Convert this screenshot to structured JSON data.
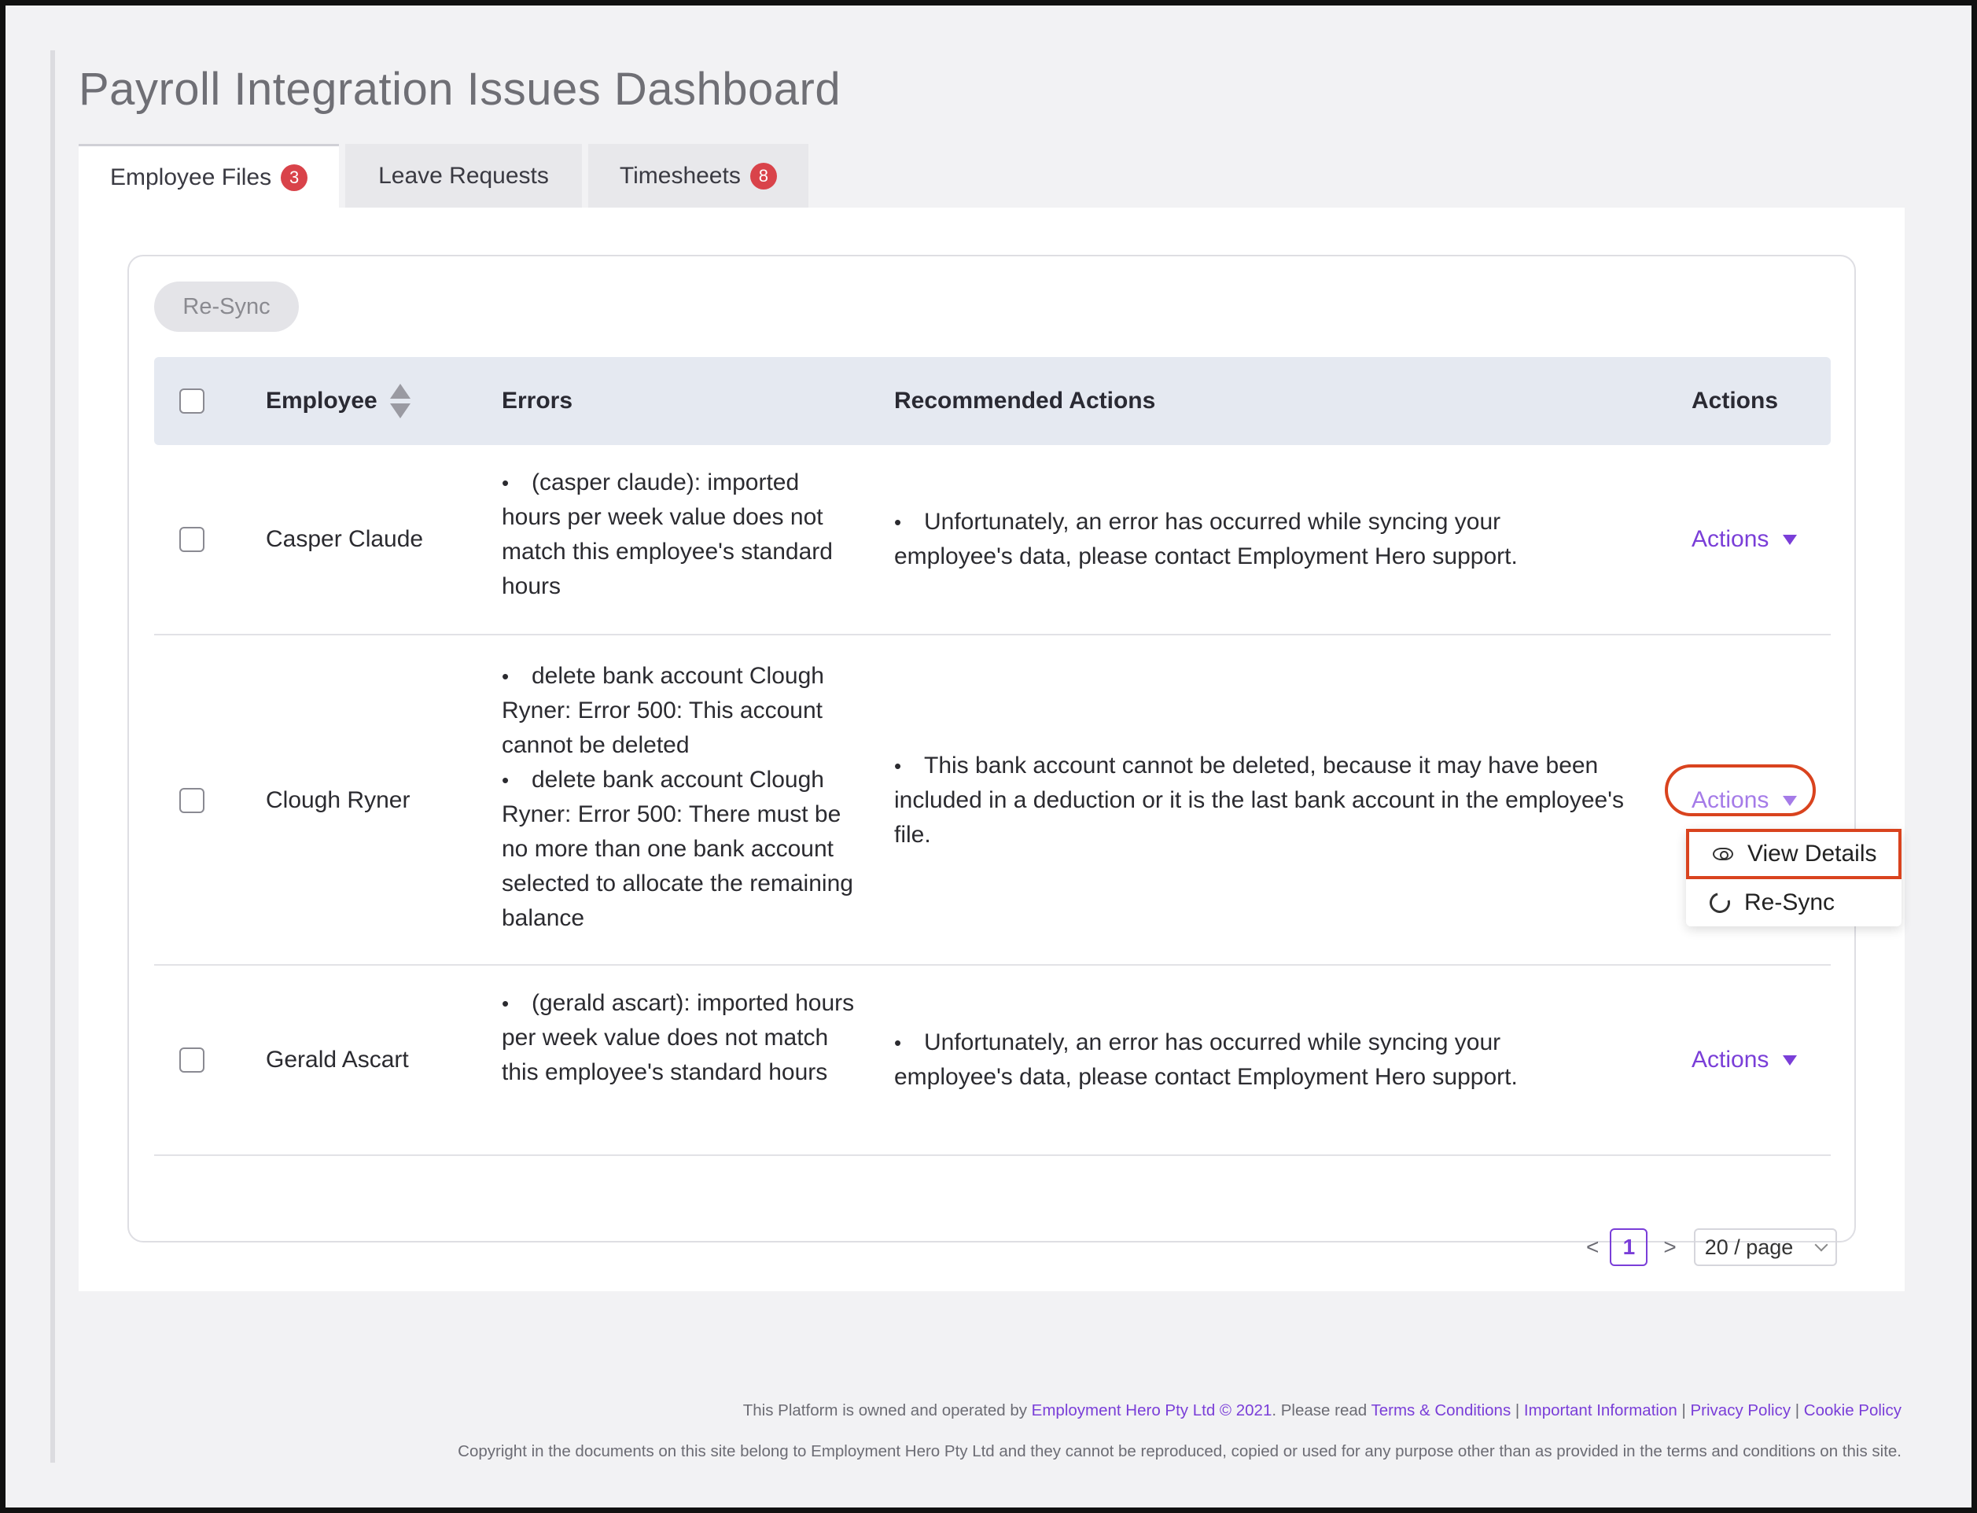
{
  "page": {
    "title": "Payroll Integration Issues Dashboard"
  },
  "tabs": [
    {
      "label": "Employee Files",
      "badge": "3",
      "active": true
    },
    {
      "label": "Leave Requests",
      "badge": "",
      "active": false
    },
    {
      "label": "Timesheets",
      "badge": "8",
      "active": false
    }
  ],
  "toolbar": {
    "resync_label": "Re-Sync"
  },
  "table": {
    "columns": {
      "employee": "Employee",
      "errors": "Errors",
      "recommended": "Recommended Actions",
      "actions": "Actions"
    },
    "rows": [
      {
        "employee": "Casper Claude",
        "errors": [
          "(casper claude): imported hours per week value does not match this employee's standard hours"
        ],
        "recommended": [
          "Unfortunately, an error has occurred while syncing your employee's data, please contact Employment Hero support."
        ],
        "action_label": "Actions"
      },
      {
        "employee": "Clough Ryner",
        "errors": [
          "delete bank account Clough Ryner: Error 500: This account cannot be deleted",
          "delete bank account Clough Ryner: Error 500: There must be no more than one bank account selected to allocate the remaining balance"
        ],
        "recommended": [
          "This bank account cannot be deleted, because it may have been included in a deduction or it is the last bank account in the employee's file."
        ],
        "action_label": "Actions"
      },
      {
        "employee": "Gerald Ascart",
        "errors": [
          "(gerald ascart): imported hours per week value does not match this employee's standard hours"
        ],
        "recommended": [
          "Unfortunately, an error has occurred while syncing your employee's data, please contact Employment Hero support."
        ],
        "action_label": "Actions"
      }
    ]
  },
  "dropdown": {
    "view_details": "View Details",
    "resync": "Re-Sync"
  },
  "pagination": {
    "prev": "<",
    "current": "1",
    "next": ">",
    "page_size": "20 / page"
  },
  "footer": {
    "line1_prefix": "This Platform is owned and operated by ",
    "company_link": "Employment Hero Pty Ltd © 2021",
    "line1_mid": ". Please read ",
    "terms": "Terms & Conditions",
    "important": "Important Information",
    "privacy": "Privacy Policy",
    "cookie": "Cookie Policy",
    "separator": " | ",
    "line2": "Copyright in the documents on this site belong to Employment Hero Pty Ltd and they cannot be reproduced, copied or used for any purpose other than as provided in the terms and conditions on this site."
  },
  "colors": {
    "accent": "#7a3ed8",
    "badge": "#d9434a",
    "highlight": "#d9431e",
    "header_bg": "#e5e9f1"
  }
}
